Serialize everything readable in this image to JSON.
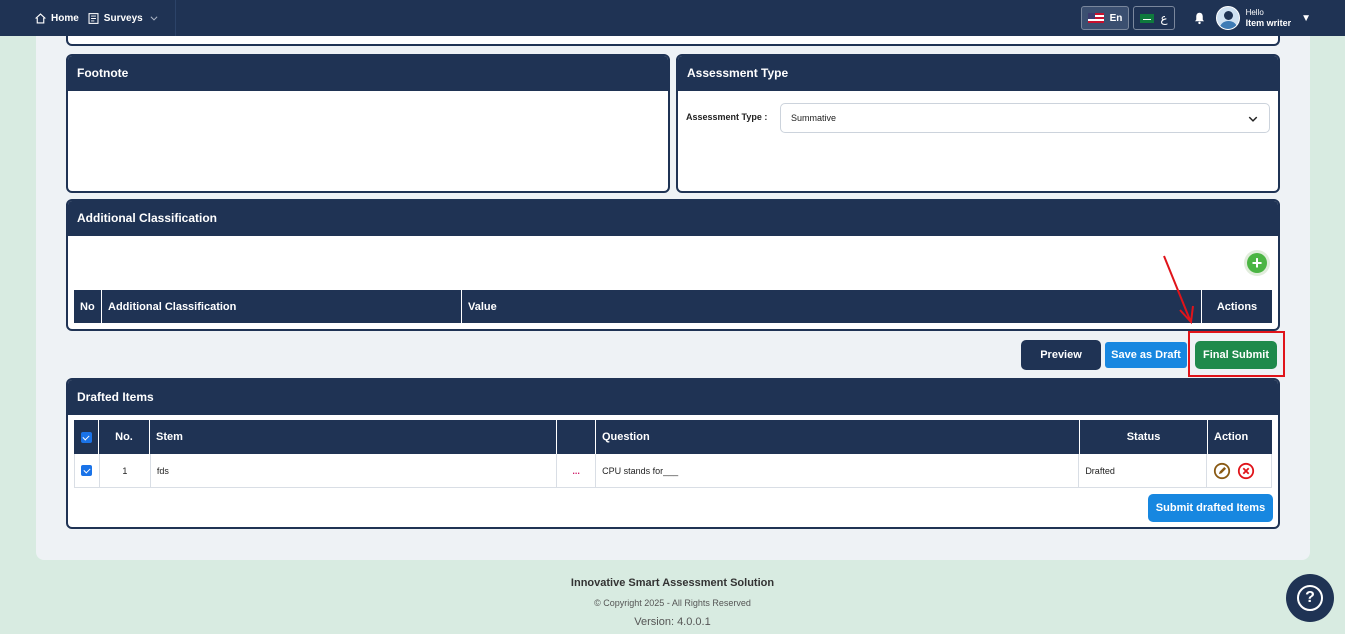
{
  "nav": {
    "home_label": "Home",
    "surveys_label": "Surveys",
    "lang_en": "En",
    "lang_ar": "ع",
    "user_greeting": "Hello",
    "user_name": "Item writer"
  },
  "footnote": {
    "title": "Footnote"
  },
  "assessment_type": {
    "title": "Assessment Type",
    "field_label": "Assessment Type :",
    "selected_value": "Summative"
  },
  "additional_classification": {
    "title": "Additional Classification",
    "columns": [
      "No",
      "Additional Classification",
      "Value",
      "Actions"
    ]
  },
  "actions": {
    "preview_label": "Preview",
    "save_draft_label": "Save as Draft",
    "final_submit_label": "Final Submit"
  },
  "drafted_items": {
    "title": "Drafted Items",
    "columns": [
      "No.",
      "Stem",
      "",
      "Question",
      "Status",
      "Action"
    ],
    "rows": [
      {
        "no": "1",
        "stem": "fds",
        "more": "...",
        "question": "CPU stands for___",
        "status": "Drafted"
      }
    ],
    "submit_label": "Submit drafted Items"
  },
  "footer": {
    "product": "Innovative Smart Assessment Solution",
    "copyright": "© Copyright 2025 - All Rights Reserved",
    "version": "Version: 4.0.0.1"
  },
  "colors": {
    "navy": "#1f3354",
    "blue": "#1787e0",
    "green": "#1f8a4c",
    "highlight_red": "#e0141a",
    "background": "#d8ebe1"
  },
  "icons": [
    "home-icon",
    "surveys-icon",
    "chevron-down-icon",
    "bell-icon",
    "avatar",
    "caret-down-icon",
    "plus-icon",
    "edit-icon",
    "delete-icon",
    "help-icon"
  ]
}
